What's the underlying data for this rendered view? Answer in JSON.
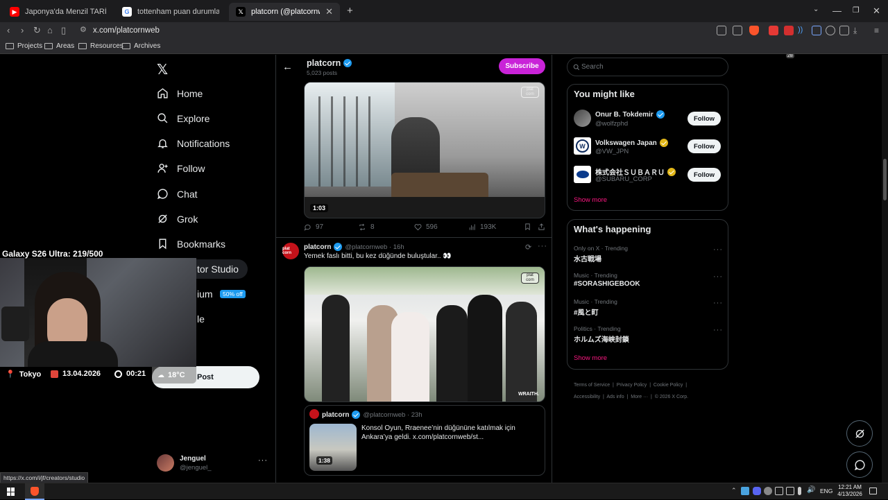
{
  "browser": {
    "tabs": [
      {
        "title": "Japonya'da Menzil TARİKATI!? | ♥ Na",
        "favicon": "youtube-icon"
      },
      {
        "title": "tottenham puan durumları - Google",
        "favicon": "google-icon"
      },
      {
        "title": "platcorn (@platcornweb) / X",
        "favicon": "x-icon"
      }
    ],
    "url": "x.com/platcornweb",
    "bookmarks": [
      "Projects",
      "Areas",
      "Resources",
      "Archives"
    ],
    "status_url": "https://x.com/i/jf/creators/studio",
    "ext_badge": "28"
  },
  "nav": {
    "items": [
      "Home",
      "Explore",
      "Notifications",
      "Follow",
      "Chat",
      "Grok",
      "Bookmarks"
    ],
    "creator_studio_fragment": "tor Studio",
    "premium_fragment": "ium",
    "premium_badge": "50% off",
    "profile_fragment": "le",
    "post_label": "Post",
    "user_name": "Jenguel",
    "user_handle": "@jenguel_"
  },
  "header": {
    "name": "platcorn",
    "posts": "5,023 posts",
    "subscribe": "Subscribe"
  },
  "post1": {
    "video_duration": "1:03",
    "replies": "97",
    "reposts": "8",
    "likes": "596",
    "views": "193K"
  },
  "post2": {
    "name": "platcorn",
    "meta": "@platcornweb · 16h",
    "text": "Yemek faslı bitti, bu kez düğünde buluştular.. 👀",
    "watermark": "WRAITH.",
    "quoted": {
      "name": "platcorn",
      "meta": "@platcornweb · 23h",
      "text": "Konsol Oyun, Rraenee’nin düğününe katılmak için Ankara’ya geldi.  x.com/platcornweb/st...",
      "duration": "1:38"
    }
  },
  "right": {
    "search_placeholder": "Search",
    "might_like_title": "You might like",
    "suggestions": [
      {
        "name": "Onur B. Tokdemir",
        "handle": "@wolfzphd",
        "badge": "blue"
      },
      {
        "name": "Volkswagen Japan",
        "handle": "@VW_JPN",
        "badge": "gold"
      },
      {
        "name": "株式会社ＳＵＢＡＲＵ",
        "handle": "@SUBARU_CORP",
        "badge": "gold"
      }
    ],
    "follow_label": "Follow",
    "show_more": "Show more",
    "happening_title": "What's happening",
    "trends": [
      {
        "meta": "Only on X · Trending",
        "name": "水古戦場"
      },
      {
        "meta": "Music · Trending",
        "name": "#SORASHIGEBOOK"
      },
      {
        "meta": "Music · Trending",
        "name": "#風と町"
      },
      {
        "meta": "Politics · Trending",
        "name": "ホルムズ海峡封鎖"
      }
    ],
    "footer": [
      "Terms of Service",
      "Privacy Policy",
      "Cookie Policy",
      "Accessibility",
      "Ads info",
      "More ···",
      "© 2026 X Corp."
    ]
  },
  "overlay": {
    "counter": "Galaxy S26 Ultra: 219/500",
    "location": "Tokyo",
    "date": "13.04.2026",
    "time": "00:21",
    "weather": "18°C"
  },
  "taskbar": {
    "lang": "ENG",
    "time": "12:21 AM",
    "date": "4/13/2026"
  },
  "colors": {
    "accent_blue": "#1d9bf0",
    "subscribe": "#c923d8",
    "show_more": "#f91880"
  }
}
